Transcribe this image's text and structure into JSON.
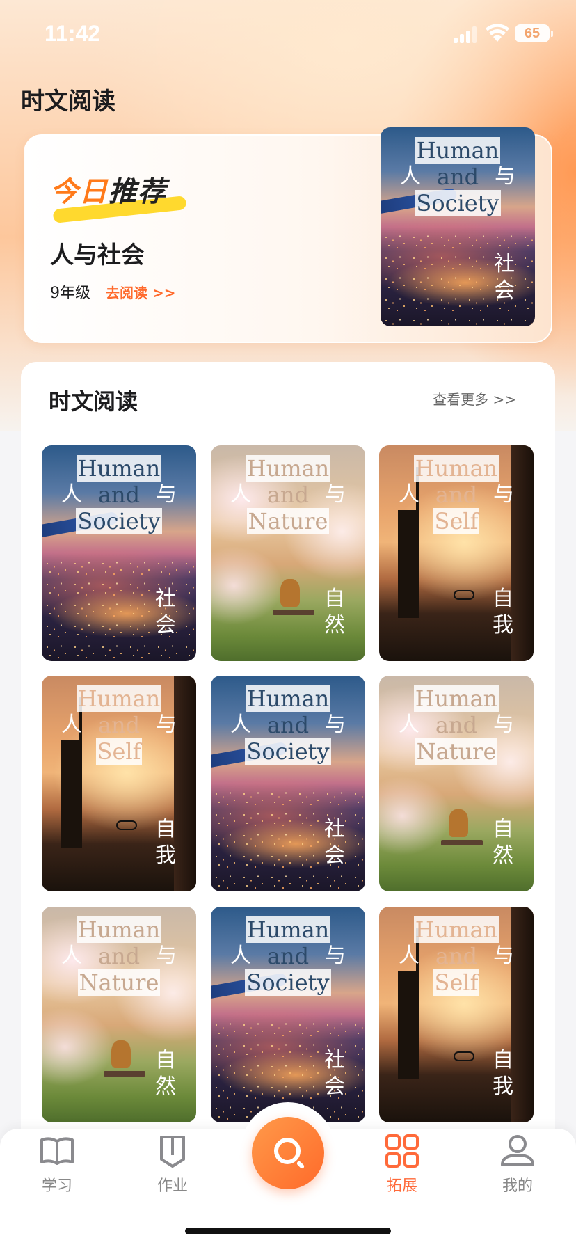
{
  "status_bar": {
    "time": "11:42",
    "battery": "65"
  },
  "page": {
    "title": "时文阅读"
  },
  "hero": {
    "badge_part1": "今日",
    "badge_part2": "推荐",
    "title": "人与社会",
    "grade": "9年级",
    "link": "去阅读 >>",
    "cover": {
      "theme": "society",
      "en1": "Human",
      "en2": "and",
      "en3": "Society",
      "cn_left": "人",
      "cn_right": "与",
      "cn_tag": "社会"
    }
  },
  "section": {
    "title": "时文阅读",
    "more": "查看更多 >>",
    "books": [
      {
        "theme": "society",
        "en1": "Human",
        "en2": "and",
        "en3": "Society",
        "cn_left": "人",
        "cn_right": "与",
        "cn_tag": "社会"
      },
      {
        "theme": "nature",
        "en1": "Human",
        "en2": "and",
        "en3": "Nature",
        "cn_left": "人",
        "cn_right": "与",
        "cn_tag": "自然"
      },
      {
        "theme": "self",
        "en1": "Human",
        "en2": "and",
        "en3": "Self",
        "cn_left": "人",
        "cn_right": "与",
        "cn_tag": "自我"
      },
      {
        "theme": "self",
        "en1": "Human",
        "en2": "and",
        "en3": "Self",
        "cn_left": "人",
        "cn_right": "与",
        "cn_tag": "自我"
      },
      {
        "theme": "society",
        "en1": "Human",
        "en2": "and",
        "en3": "Society",
        "cn_left": "人",
        "cn_right": "与",
        "cn_tag": "社会"
      },
      {
        "theme": "nature",
        "en1": "Human",
        "en2": "and",
        "en3": "Nature",
        "cn_left": "人",
        "cn_right": "与",
        "cn_tag": "自然"
      },
      {
        "theme": "nature",
        "en1": "Human",
        "en2": "and",
        "en3": "Nature",
        "cn_left": "人",
        "cn_right": "与",
        "cn_tag": "自然"
      },
      {
        "theme": "society",
        "en1": "Human",
        "en2": "and",
        "en3": "Society",
        "cn_left": "人",
        "cn_right": "与",
        "cn_tag": "社会"
      },
      {
        "theme": "self",
        "en1": "Human",
        "en2": "and",
        "en3": "Self",
        "cn_left": "人",
        "cn_right": "与",
        "cn_tag": "自我"
      }
    ]
  },
  "tabbar": {
    "tabs": [
      {
        "label": "学习",
        "icon": "book-icon"
      },
      {
        "label": "作业",
        "icon": "homework-icon"
      },
      {
        "label": "拓展",
        "icon": "grid-icon",
        "active": true
      },
      {
        "label": "我的",
        "icon": "user-icon"
      }
    ],
    "center_icon": "search-icon"
  },
  "colors": {
    "accent": "#ff6a3a",
    "title": "#1c1c1e",
    "muted": "#888888"
  }
}
